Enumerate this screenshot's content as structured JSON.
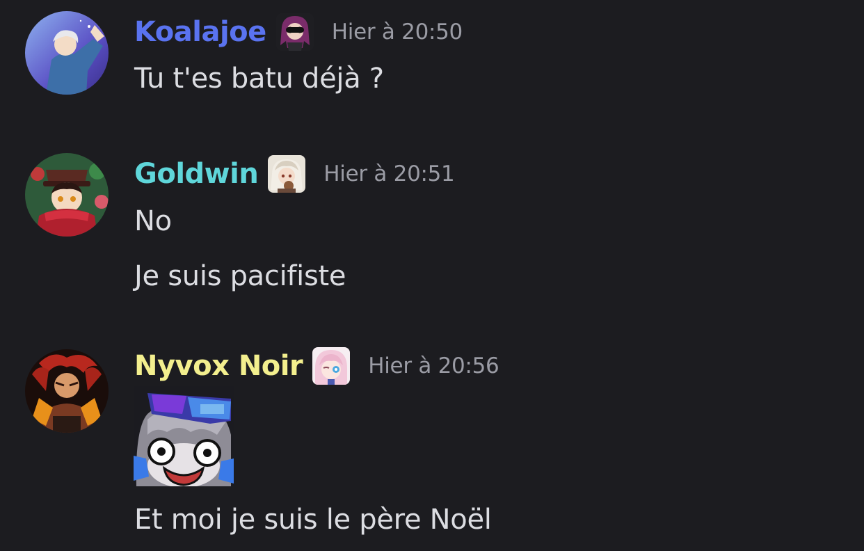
{
  "messages": [
    {
      "username": "Koalajoe",
      "username_color": "#5a73f0",
      "timestamp": "Hier à 20:50",
      "lines": [
        "Tu t'es batu déjà ?"
      ]
    },
    {
      "username": "Goldwin",
      "username_color": "#5fd6da",
      "timestamp": "Hier à 20:51",
      "lines": [
        "No",
        "Je suis pacifiste"
      ]
    },
    {
      "username": "Nyvox Noir",
      "username_color": "#f3ef8e",
      "timestamp": "Hier à 20:56",
      "attachment": "sticker-image",
      "lines": [
        "Et moi je suis le père Noël"
      ]
    }
  ],
  "colors": {
    "background": "#1c1c20",
    "message_text": "#dcdde2",
    "timestamp_text": "#9b9ca5"
  }
}
